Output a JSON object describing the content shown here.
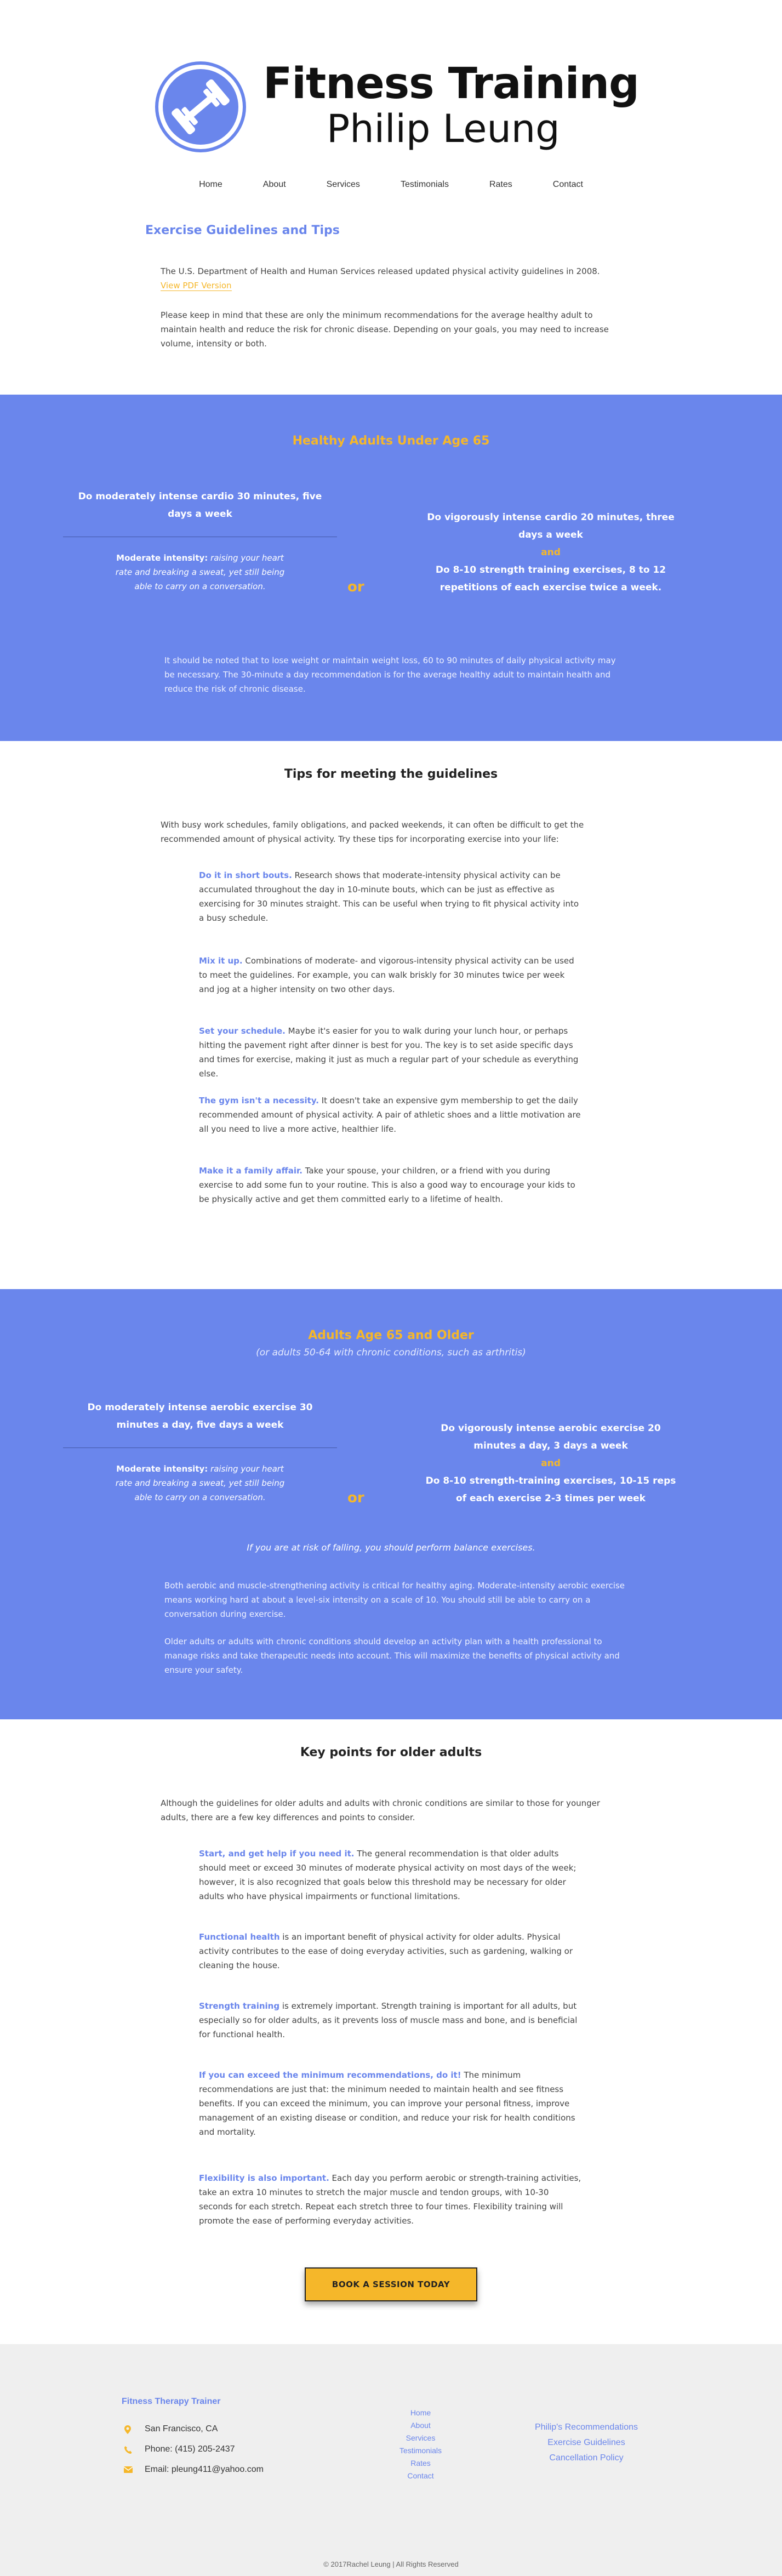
{
  "header": {
    "title": "Fitness Training",
    "subtitle": "Philip Leung",
    "nav": [
      "Home",
      "About",
      "Services",
      "Testimonials",
      "Rates",
      "Contact"
    ]
  },
  "intro": {
    "heading": "Exercise Guidelines and Tips",
    "p1": "The U.S. Department of Health and Human Services released updated physical activity guidelines in 2008. ",
    "p1_link": "View PDF Version",
    "p2": "Please keep in mind that these are only the minimum recommendations for the average healthy adult to maintain health and reduce the risk for chronic disease. Depending on your goals, you may need to increase volume, intensity or both."
  },
  "band1": {
    "title": "Healthy Adults Under Age 65",
    "left_heading": "Do moderately intense cardio 30 minutes, five days a week",
    "left_bold": "Moderate intensity:",
    "left_text": " raising your heart rate and breaking a sweat, yet still being able to carry on a conversation.",
    "or": "or",
    "right_1": "Do vigorously intense cardio 20 minutes, three days a week",
    "right_and": "and",
    "right_2": "Do 8-10 strength training exercises, 8 to 12 repetitions of each exercise twice a week.",
    "note": "It should be noted that to lose weight or maintain weight loss, 60 to 90 minutes of daily physical activity may be necessary. The 30-minute a day recommendation is for the average healthy adult to maintain health and reduce the risk of chronic disease."
  },
  "tips1": {
    "heading": "Tips for meeting the guidelines",
    "lead": "With busy work schedules, family obligations, and packed weekends, it can often be difficult to get the recommended amount of physical activity. Try these tips for incorporating exercise into your life:",
    "items": [
      {
        "k": "Do it in short bouts.",
        "t": " Research shows that moderate-intensity physical activity can be accumulated throughout the day in 10-minute bouts, which can be just as effective as exercising for 30 minutes straight. This can be useful when trying to fit physical activity into a busy schedule."
      },
      {
        "k": "Mix it up.",
        "t": " Combinations of moderate- and vigorous-intensity physical activity can be used to meet the guidelines. For example, you can walk briskly for 30 minutes twice per week and jog at a higher intensity on two other days."
      },
      {
        "k": "Set your schedule.",
        "t": " Maybe it's easier for you to walk during your lunch hour, or perhaps hitting the pavement right after dinner is best for you. The key is to set aside specific days and times for exercise, making it just as much a regular part of your schedule as everything else."
      },
      {
        "k": "The gym isn't a necessity.",
        "t": " It doesn't take an expensive gym membership to get the daily recommended amount of physical activity. A pair of athletic shoes and a little motivation are all you need to live a more active, healthier life."
      },
      {
        "k": "Make it a family affair.",
        "t": " Take your spouse, your children, or a friend with you during exercise to add some fun to your routine. This is also a good way to encourage your kids to be physically active and get them committed early to a lifetime of health."
      }
    ]
  },
  "band2": {
    "title": "Adults Age 65 and Older",
    "subtitle": "(or adults 50-64 with chronic conditions, such as arthritis)",
    "left_heading": "Do moderately intense aerobic exercise 30 minutes a day, five days a week",
    "left_bold": "Moderate intensity:",
    "left_text": " raising your heart rate and breaking a sweat, yet still being able to carry on a conversation.",
    "or": "or",
    "right_1": "Do vigorously intense aerobic exercise 20 minutes a day, 3 days a week",
    "right_and": "and",
    "right_2": "Do 8-10 strength-training exercises, 10-15 reps of each exercise 2-3 times per week",
    "italic_note": "If you are at risk of falling, you should perform balance exercises.",
    "note1": "Both aerobic and muscle-strengthening activity is critical for healthy aging. Moderate-intensity aerobic exercise means working hard at about a level-six intensity on a scale of 10. You should still be able to carry on a conversation during exercise.",
    "note2": "Older adults or adults with chronic conditions should develop an activity plan with a health professional to manage risks and take therapeutic needs into account. This will maximize the benefits of physical activity and ensure your safety."
  },
  "tips2": {
    "heading": "Key points for older adults",
    "lead": "Although the guidelines for older adults and adults with chronic conditions are similar to those for younger adults, there are a few key differences and points to consider.",
    "items": [
      {
        "k": "Start, and get help if you need it.",
        "t": " The general recommendation is that older adults should meet or exceed 30 minutes of moderate physical activity on most days of the week; however, it is also recognized that goals below this threshold may be necessary for older adults who have physical impairments or functional limitations."
      },
      {
        "k": "Functional health",
        "t": " is an important benefit of physical activity for older adults. Physical activity contributes to the ease of doing everyday activities, such as gardening, walking or cleaning the house."
      },
      {
        "k": "Strength training",
        "t": " is extremely important. Strength training is important for all adults, but especially so for older adults, as it prevents loss of muscle mass and bone, and is beneficial for functional health."
      },
      {
        "k": "If you can exceed the minimum recommendations, do it!",
        "t": " The minimum recommendations are just that: the minimum needed to maintain health and see fitness benefits. If you can exceed the minimum, you can improve your personal fitness, improve management of an existing disease or condition, and reduce your risk for health conditions and mortality."
      },
      {
        "k": "Flexibility is also important.",
        "t": " Each day you perform aerobic or strength-training activities, take an extra 10 minutes to stretch the major muscle and tendon groups, with 10-30 seconds for each stretch. Repeat each stretch three to four times. Flexibility training will promote the ease of performing everyday activities."
      }
    ],
    "cta": "BOOK A SESSION TODAY"
  },
  "footer": {
    "title": "Fitness Therapy Trainer",
    "location": "San Francisco, CA",
    "phone": "Phone: (415) 205-2437",
    "email": "Email: pleung411@yahoo.com",
    "links": [
      "Home",
      "About",
      "Services",
      "Testimonials",
      "Rates",
      "Contact"
    ],
    "links2": [
      "Philip's Recommendations",
      "Exercise Guidelines",
      "Cancellation Policy"
    ],
    "copyright": "© 2017Rachel Leung | All Rights Reserved"
  },
  "colors": {
    "accent": "#6a86ec",
    "orange": "#f5b72a"
  },
  "icons": [
    "dumbbell-logo-icon",
    "location-pin-icon",
    "phone-icon",
    "envelope-icon"
  ]
}
